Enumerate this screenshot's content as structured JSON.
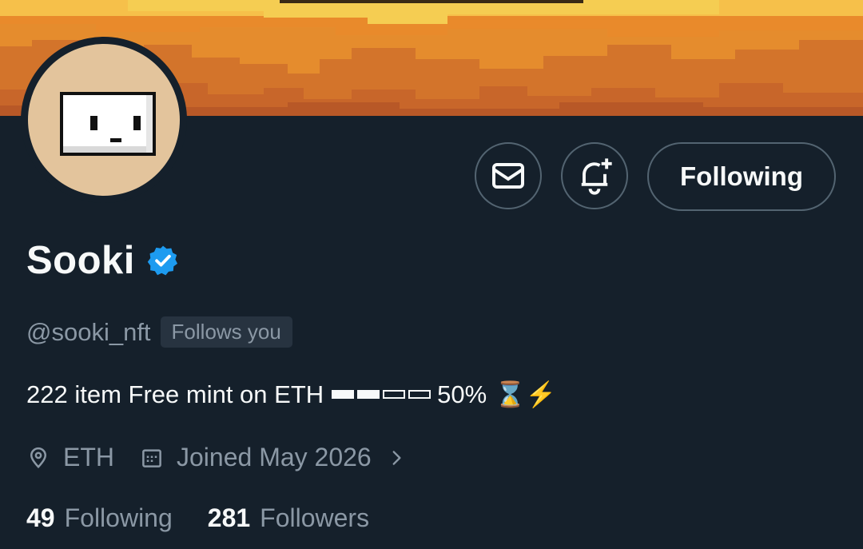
{
  "profile": {
    "name": "Sooki",
    "handle": "@sooki_nft",
    "follows_you_badge": "Follows you",
    "bio_text": "222 item Free mint on ETH",
    "bio_progress_percent": "50%",
    "bio_progress_fraction": 0.5,
    "bio_emojis": "⌛⚡",
    "location": "ETH",
    "joined": "Joined May 2026",
    "following_count": "49",
    "following_label": "Following",
    "followers_count": "281",
    "followers_label": "Followers"
  },
  "actions": {
    "message_icon": "envelope-icon",
    "notify_icon": "bell-plus-icon",
    "follow_state_label": "Following"
  },
  "colors": {
    "background": "#15202b",
    "text_primary": "#f7f9f9",
    "text_secondary": "#8b98a5",
    "border": "#536471",
    "verified_blue": "#1d9bf0",
    "banner_orange": "#e98a2b",
    "avatar_bg": "#e3c49c"
  }
}
